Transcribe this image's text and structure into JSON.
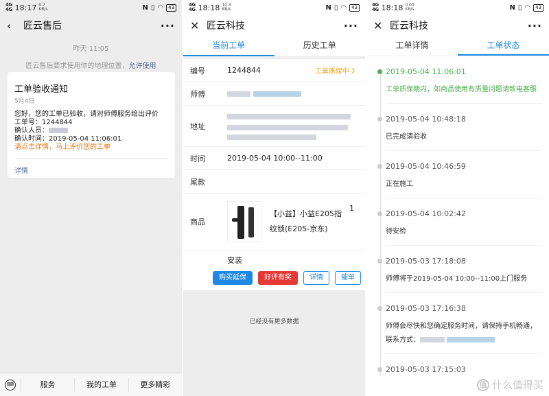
{
  "panel1": {
    "status": {
      "signal": "4G\n4G",
      "time": "18:17",
      "speed": "0.7\nKB/s",
      "nfc": "N",
      "battery": "43"
    },
    "nav": {
      "back_icon": "chevron-left-icon",
      "title": "匠云售后",
      "more": "···"
    },
    "timestamp": "昨天 11:05",
    "system_msg": "匠云售后要求使用你的地理位置，",
    "system_link": "允许使用",
    "card": {
      "title": "工单验收通知",
      "date": "5月4日",
      "line1": "您好，您的工单已验收，请对师傅服务给出评价",
      "line2": "工单号：1244844",
      "line3_label": "确认人员：",
      "line4": "确认时间：2019-05-04 11:06:01",
      "line5": "请点击详情，马上评价您的工单",
      "detail": "详情"
    },
    "bottom": {
      "keyboard_icon": "keyboard-icon",
      "menus": [
        "服务",
        "我的工单",
        "更多精彩"
      ]
    }
  },
  "panel2": {
    "status": {
      "signal": "4G\n4G",
      "time": "18:18",
      "speed": "10.3\nKB/s",
      "nfc": "N",
      "battery": "43"
    },
    "nav": {
      "close_icon": "close-icon",
      "title": "匠云科技",
      "more": "···"
    },
    "tabs": [
      "当前工单",
      "历史工单"
    ],
    "order": {
      "id_label": "编号",
      "id": "1244844",
      "status": "工单质保中 》",
      "master_label": "师傅",
      "addr_label": "地址",
      "time_label": "时间",
      "time": "2019-05-04 10:00--11:00",
      "tail_label": "尾款",
      "goods_label": "商品",
      "goods_name": "【小益】小益E205指纹锁(E205-京东)",
      "goods_qty": "1",
      "install": "安装"
    },
    "buttons": [
      "购买延保",
      "好评有奖",
      "详情",
      "催单"
    ],
    "no_more": "已经没有更多数据"
  },
  "panel3": {
    "status": {
      "signal": "4G\n4G",
      "time": "18:18",
      "speed": "0.00\nKB/s",
      "nfc": "N",
      "battery": "43"
    },
    "nav": {
      "close_icon": "close-icon",
      "title": "匠云科技",
      "more": "···"
    },
    "tabs": [
      "工单详情",
      "工单状态"
    ],
    "timeline": [
      {
        "time": "2019-05-04 11:06:01",
        "text": "工单质保期内，如商品使用有质量问题请致电客服",
        "active": true
      },
      {
        "time": "2019-05-04 10:48:18",
        "text": "已完成请验收",
        "active": false
      },
      {
        "time": "2019-05-04 10:46:59",
        "text": "正在施工",
        "active": false
      },
      {
        "time": "2019-05-04 10:02:42",
        "text": "待安检",
        "active": false
      },
      {
        "time": "2019-05-03 17:18:08",
        "text": "师傅将于2019-05-04 10:00--11:00上门服务",
        "active": false
      },
      {
        "time": "2019-05-03 17:16:38",
        "text": "师傅会尽快和您确定服务时间，请保持手机畅通，",
        "text2": "联系方式：",
        "active": false
      },
      {
        "time": "2019-05-03 17:15:03",
        "text": "",
        "active": false
      }
    ],
    "watermark": {
      "badge": "值",
      "text": "什么值得买"
    }
  }
}
